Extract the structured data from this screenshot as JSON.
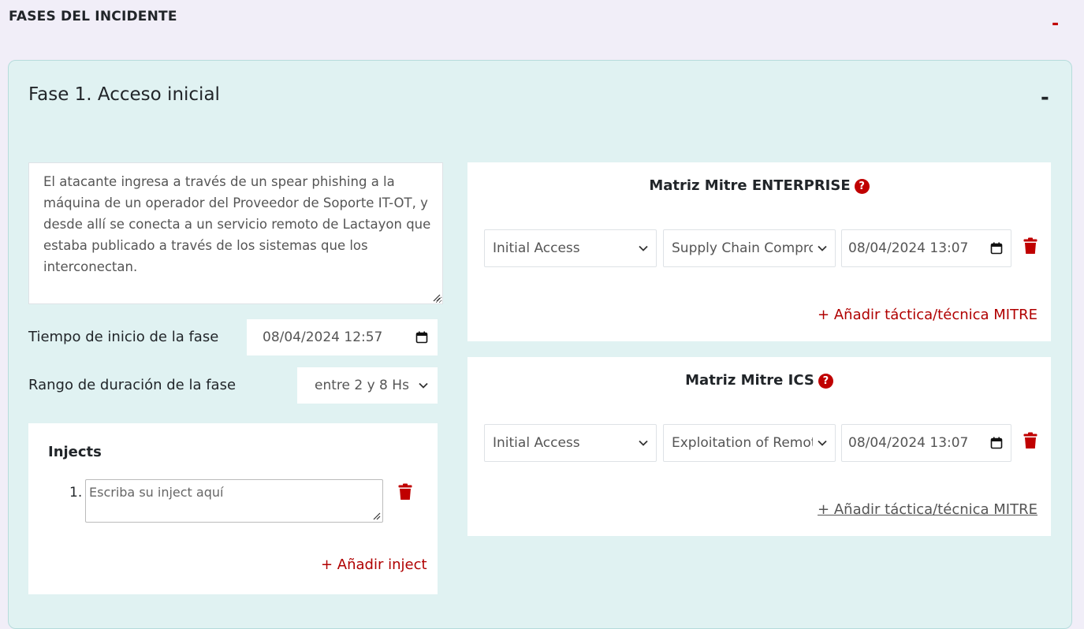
{
  "section": {
    "title": "FASES DEL INCIDENTE",
    "collapse": "-"
  },
  "phase": {
    "title": "Fase 1. Acceso inicial",
    "collapse": "-",
    "description": "El atacante ingresa a través de un spear phishing a la máquina de un operador del Proveedor de Soporte IT-OT, y desde allí se conecta a un servicio remoto de Lactayon que estaba publicado a través de los sistemas que los interconectan.",
    "start_label": "Tiempo de inicio de la fase",
    "start_value": "08/04/2024  12:57",
    "duration_label": "Rango de duración de la fase",
    "duration_value": "entre 2 y 8 Hs"
  },
  "injects": {
    "title": "Injects",
    "items": [
      {
        "number": "1.",
        "placeholder": "Escriba su inject aquí"
      }
    ],
    "add_label": "+ Añadir inject"
  },
  "enterprise": {
    "title": "Matriz Mitre ENTERPRISE",
    "tactic": "Initial Access",
    "technique": "Supply Chain Compromise",
    "datetime": "08/04/2024  13:07",
    "add_label": "+ Añadir táctica/técnica MITRE"
  },
  "ics": {
    "title": "Matriz Mitre ICS",
    "tactic": "Initial Access",
    "technique": "Exploitation of Remote Services",
    "datetime": "08/04/2024  13:07",
    "add_label": "+ Añadir táctica/técnica MITRE"
  },
  "icons": [
    "calendar-icon",
    "chevron-down-icon",
    "trash-icon",
    "help-icon",
    "resize-grip-icon"
  ],
  "colors": {
    "accent_red": "#c00000",
    "panel_bg": "#e0f2f2",
    "page_bg": "#f1eef8"
  }
}
